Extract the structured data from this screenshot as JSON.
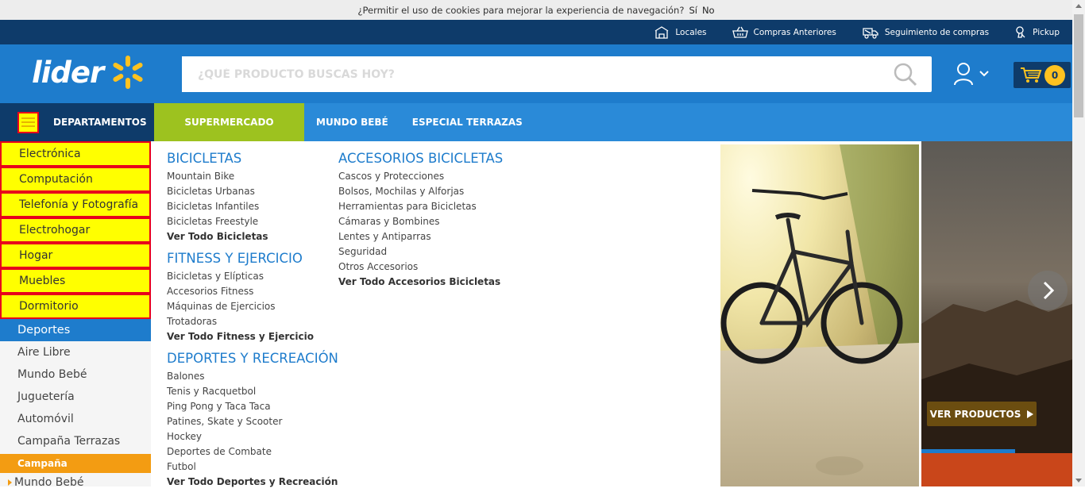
{
  "cookie": {
    "message": "¿Permitir el uso de cookies para mejorar la experiencia de navegación?",
    "yes": "Sí",
    "no": "No"
  },
  "topbar": {
    "links": [
      {
        "label": "Locales",
        "icon": "store-icon"
      },
      {
        "label": "Compras Anteriores",
        "icon": "basket-icon"
      },
      {
        "label": "Seguimiento de compras",
        "icon": "truck-icon"
      },
      {
        "label": "Pickup",
        "icon": "pickup-icon"
      }
    ]
  },
  "header": {
    "logo": "lider",
    "search_placeholder": "¿QUÉ PRODUCTO BUSCAS HOY?",
    "cart_count": "0"
  },
  "nav": {
    "departments": "DEPARTAMENTOS",
    "supermercado": "SUPERMERCADO",
    "mundo_bebe": "MUNDO BEBÉ",
    "terrazas": "ESPECIAL TERRAZAS"
  },
  "sidebar": {
    "highlighted": [
      "Electrónica",
      "Computación",
      "Telefonía y Fotografía",
      "Electrohogar",
      "Hogar",
      "Muebles",
      "Dormitorio"
    ],
    "active": "Deportes",
    "items": [
      "Aire Libre",
      "Mundo Bebé",
      "Juguetería",
      "Automóvil",
      "Campaña Terrazas"
    ],
    "campaign": "Campaña",
    "campaign_sub": "Mundo Bebé"
  },
  "mega": {
    "bicicletas": {
      "title": "BICICLETAS",
      "links": [
        "Mountain Bike",
        "Bicicletas Urbanas",
        "Bicicletas Infantiles",
        "Bicicletas Freestyle"
      ],
      "all": "Ver Todo Bicicletas"
    },
    "fitness": {
      "title": "FITNESS Y EJERCICIO",
      "links": [
        "Bicicletas y Elípticas",
        "Accesorios Fitness",
        "Máquinas de Ejercicios",
        "Trotadoras"
      ],
      "all": "Ver Todo Fitness y Ejercicio"
    },
    "deportes": {
      "title": "DEPORTES Y RECREACIÓN",
      "links": [
        "Balones",
        "Tenis y Racquetbol",
        "Ping Pong y Taca Taca",
        "Patines, Skate y Scooter",
        "Hockey",
        "Deportes de Combate",
        "Futbol"
      ],
      "all": "Ver Todo Deportes y Recreación"
    },
    "accesorios": {
      "title": "ACCESORIOS BICICLETAS",
      "links": [
        "Cascos y Protecciones",
        "Bolsos, Mochilas y Alforjas",
        "Herramientas para Bicicletas",
        "Cámaras y Bombines",
        "Lentes y Antiparras",
        "Seguridad",
        "Otros Accesorios"
      ],
      "all": "Ver Todo Accesorios Bicicletas"
    }
  },
  "hero": {
    "button": "VER PRODUCTOS"
  },
  "colors": {
    "brand_blue": "#1e7ccc",
    "dark_blue": "#0e3b6a",
    "nav_blue": "#2a8ad8",
    "green": "#9dc21f",
    "yellow": "#ffc220",
    "highlight": "#ffff00",
    "orange": "#f39c12"
  }
}
